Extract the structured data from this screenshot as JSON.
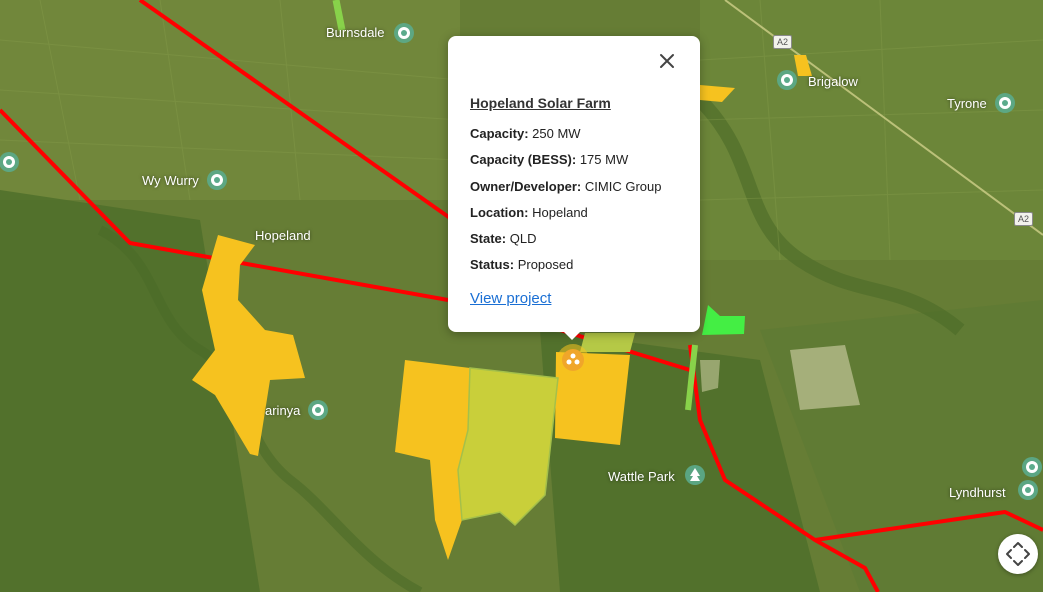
{
  "map": {
    "places": [
      {
        "id": "burnsdale",
        "label": "Burnsdale"
      },
      {
        "id": "brigalow",
        "label": "Brigalow"
      },
      {
        "id": "tyrone",
        "label": "Tyrone"
      },
      {
        "id": "wy-wurry",
        "label": "Wy Wurry"
      },
      {
        "id": "hopeland",
        "label": "Hopeland"
      },
      {
        "id": "warinya",
        "label": "arinya"
      },
      {
        "id": "wattle-park",
        "label": "Wattle Park"
      },
      {
        "id": "lyndhurst",
        "label": "Lyndhurst"
      }
    ],
    "road_shields": [
      "A2",
      "A2"
    ]
  },
  "popup": {
    "title": "Hopeland Solar Farm",
    "fields": [
      {
        "label": "Capacity:",
        "value": "250 MW"
      },
      {
        "label": "Capacity (BESS):",
        "value": "175 MW"
      },
      {
        "label": "Owner/Developer:",
        "value": "CIMIC Group"
      },
      {
        "label": "Location:",
        "value": "Hopeland"
      },
      {
        "label": "State:",
        "value": "QLD"
      },
      {
        "label": "Status:",
        "value": "Proposed"
      }
    ],
    "link": "View project"
  },
  "colors": {
    "transmission_line": "#ff0000",
    "project_proposed": "#f6c21f",
    "project_green": "#c9cf3a",
    "project_bright": "#44ee44",
    "link": "#1a6fd4"
  }
}
